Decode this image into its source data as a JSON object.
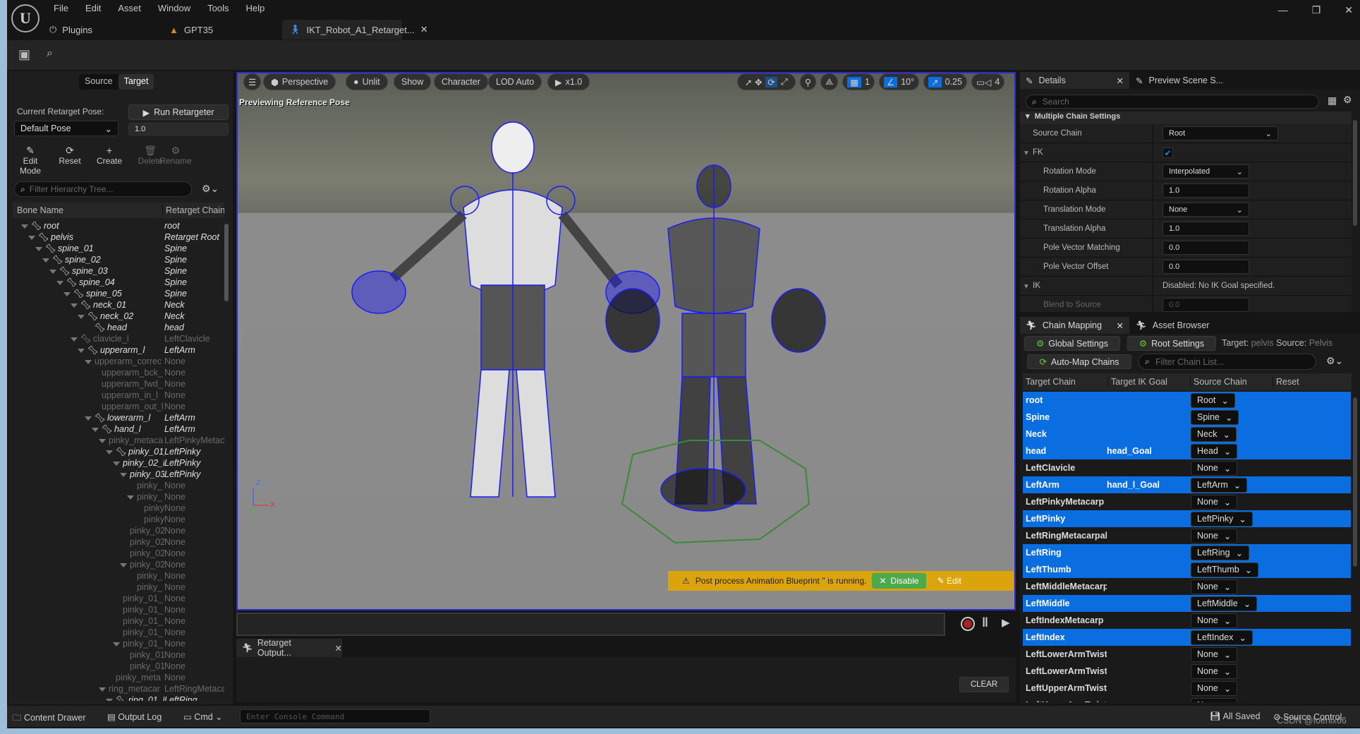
{
  "menu": [
    "File",
    "Edit",
    "Asset",
    "Window",
    "Tools",
    "Help"
  ],
  "tabs": [
    {
      "label": "Plugins",
      "icon": "plug-icon"
    },
    {
      "label": "GPT35",
      "icon": "level-icon"
    },
    {
      "label": "IKT_Robot_A1_Retarget...",
      "icon": "retargeter-icon",
      "active": true
    }
  ],
  "left": {
    "source_label": "Source",
    "target_label": "Target",
    "pose_label": "Current Retarget Pose:",
    "run_label": "Run Retargeter",
    "pose_value": "Default Pose",
    "blend_value": "1.0",
    "tools": [
      {
        "label": "Edit Mode",
        "icon": "pencil-icon"
      },
      {
        "label": "Reset",
        "icon": "reset-icon"
      },
      {
        "label": "Create",
        "icon": "plus-icon"
      },
      {
        "label": "Delete",
        "icon": "trash-icon",
        "disabled": true
      },
      {
        "label": "Rename",
        "icon": "gear-icon",
        "disabled": true
      }
    ],
    "filter_placeholder": "Filter Hierarchy Tree...",
    "col_bone": "Bone Name",
    "col_chain": "Retarget Chain"
  },
  "tree": [
    {
      "n": "root",
      "c": "root",
      "d": 0,
      "i": 1,
      "e": 1
    },
    {
      "n": "pelvis",
      "c": "Retarget Root",
      "d": 1,
      "i": 1,
      "e": 1
    },
    {
      "n": "spine_01",
      "c": "Spine",
      "d": 2,
      "i": 1,
      "e": 1
    },
    {
      "n": "spine_02",
      "c": "Spine",
      "d": 3,
      "i": 1,
      "e": 1
    },
    {
      "n": "spine_03",
      "c": "Spine",
      "d": 4,
      "i": 1,
      "e": 1
    },
    {
      "n": "spine_04",
      "c": "Spine",
      "d": 5,
      "i": 1,
      "e": 1
    },
    {
      "n": "spine_05",
      "c": "Spine",
      "d": 6,
      "i": 1,
      "e": 1
    },
    {
      "n": "neck_01",
      "c": "Neck",
      "d": 7,
      "i": 1,
      "e": 1
    },
    {
      "n": "neck_02",
      "c": "Neck",
      "d": 8,
      "i": 1,
      "e": 1
    },
    {
      "n": "head",
      "c": "head",
      "d": 9,
      "i": 1
    },
    {
      "n": "clavicle_l",
      "c": "LeftClavicle",
      "d": 7,
      "i": 1,
      "e": 1,
      "dim": 1
    },
    {
      "n": "upperarm_l",
      "c": "LeftArm",
      "d": 8,
      "i": 1,
      "e": 1
    },
    {
      "n": "upperarm_correc",
      "c": "None",
      "d": 9,
      "e": 1,
      "dim": 1
    },
    {
      "n": "upperarm_bck_",
      "c": "None",
      "d": 10,
      "dim": 1
    },
    {
      "n": "upperarm_fwd_",
      "c": "None",
      "d": 10,
      "dim": 1
    },
    {
      "n": "upperarm_in_l",
      "c": "None",
      "d": 10,
      "dim": 1
    },
    {
      "n": "upperarm_out_l",
      "c": "None",
      "d": 10,
      "dim": 1
    },
    {
      "n": "lowerarm_l",
      "c": "LeftArm",
      "d": 9,
      "i": 1,
      "e": 1
    },
    {
      "n": "hand_l",
      "c": "LeftArm",
      "d": 10,
      "i": 1,
      "e": 1
    },
    {
      "n": "pinky_metaca",
      "c": "LeftPinkyMetac",
      "d": 11,
      "e": 1,
      "dim": 1
    },
    {
      "n": "pinky_01_l",
      "c": "LeftPinky",
      "d": 12,
      "i": 1,
      "e": 1
    },
    {
      "n": "pinky_02_l",
      "c": "LeftPinky",
      "d": 13,
      "e": 1
    },
    {
      "n": "pinky_03",
      "c": "LeftPinky",
      "d": 14,
      "e": 1
    },
    {
      "n": "pinky_",
      "c": "None",
      "d": 15,
      "dim": 1
    },
    {
      "n": "pinky_",
      "c": "None",
      "d": 15,
      "e": 1,
      "dim": 1
    },
    {
      "n": "pinky",
      "c": "None",
      "d": 16,
      "dim": 1
    },
    {
      "n": "pinky",
      "c": "None",
      "d": 16,
      "dim": 1
    },
    {
      "n": "pinky_02",
      "c": "None",
      "d": 14,
      "dim": 1
    },
    {
      "n": "pinky_02",
      "c": "None",
      "d": 14,
      "dim": 1
    },
    {
      "n": "pinky_02",
      "c": "None",
      "d": 14,
      "dim": 1
    },
    {
      "n": "pinky_02",
      "c": "None",
      "d": 14,
      "e": 1,
      "dim": 1
    },
    {
      "n": "pinky_",
      "c": "None",
      "d": 15,
      "dim": 1
    },
    {
      "n": "pinky_",
      "c": "None",
      "d": 15,
      "dim": 1
    },
    {
      "n": "pinky_01_",
      "c": "None",
      "d": 13,
      "dim": 1
    },
    {
      "n": "pinky_01_",
      "c": "None",
      "d": 13,
      "dim": 1
    },
    {
      "n": "pinky_01_",
      "c": "None",
      "d": 13,
      "dim": 1
    },
    {
      "n": "pinky_01_",
      "c": "None",
      "d": 13,
      "dim": 1
    },
    {
      "n": "pinky_01_",
      "c": "None",
      "d": 13,
      "e": 1,
      "dim": 1
    },
    {
      "n": "pinky_01",
      "c": "None",
      "d": 14,
      "dim": 1
    },
    {
      "n": "pinky_01",
      "c": "None",
      "d": 14,
      "dim": 1
    },
    {
      "n": "pinky_meta",
      "c": "None",
      "d": 12,
      "dim": 1
    },
    {
      "n": "ring_metacar",
      "c": "LeftRingMetaca",
      "d": 11,
      "e": 1,
      "dim": 1
    },
    {
      "n": "ring_01_l",
      "c": "LeftRing",
      "d": 12,
      "i": 1,
      "e": 1
    }
  ],
  "viewport": {
    "buttons": [
      "Perspective",
      "Unlit",
      "Show",
      "Character",
      "LOD Auto",
      "x1.0"
    ],
    "grid_value": "1",
    "angle_value": "10°",
    "scale_value": "0.25",
    "camera_speed": "4",
    "overlay_text": "Previewing Reference Pose",
    "warning_text": "Post process Animation Blueprint '' is running.",
    "disable_label": "Disable",
    "edit_label": "Edit",
    "axis_x": "X",
    "axis_y": "Y",
    "axis_z": "Z",
    "accent": "#0a6ee0"
  },
  "output": {
    "tab_label": "Retarget Output...",
    "clear_label": "CLEAR"
  },
  "details": {
    "tab": "Details",
    "tab2": "Preview Scene S...",
    "search_placeholder": "Search",
    "section": "Multiple Chain Settings",
    "rows": [
      {
        "label": "Source Chain",
        "value": "Root",
        "type": "dropdown",
        "indent": 0
      },
      {
        "label": "FK",
        "value": "",
        "type": "checkbox",
        "checked": true,
        "indent": 0,
        "expander": true
      },
      {
        "label": "Rotation Mode",
        "value": "Interpolated",
        "type": "dropdown",
        "indent": 1
      },
      {
        "label": "Rotation Alpha",
        "value": "1.0",
        "type": "number",
        "indent": 1
      },
      {
        "label": "Translation Mode",
        "value": "None",
        "type": "dropdown",
        "indent": 1
      },
      {
        "label": "Translation Alpha",
        "value": "1.0",
        "type": "number",
        "indent": 1
      },
      {
        "label": "Pole Vector Matching",
        "value": "0.0",
        "type": "number",
        "indent": 1
      },
      {
        "label": "Pole Vector Offset",
        "value": "0.0",
        "type": "number",
        "indent": 1
      },
      {
        "label": "IK",
        "value": "Disabled: No IK Goal specified.",
        "type": "text",
        "indent": 0,
        "expander": true
      },
      {
        "label": "Blend to Source",
        "value": "0.0",
        "type": "number",
        "indent": 1,
        "dim": true
      }
    ]
  },
  "chain_mapping": {
    "tab": "Chain Mapping",
    "tab2": "Asset Browser",
    "global_settings": "Global Settings",
    "root_settings": "Root Settings",
    "target_label": "Target:",
    "target_value": "pelvis",
    "source_label": "Source:",
    "source_value": "Pelvis",
    "automap": "Auto-Map Chains",
    "filter_placeholder": "Filter Chain List...",
    "columns": [
      "Target Chain",
      "Target IK Goal",
      "Source Chain",
      "Reset"
    ],
    "rows": [
      {
        "t": "root",
        "ik": "",
        "s": "Root",
        "sel": true
      },
      {
        "t": "Spine",
        "ik": "",
        "s": "Spine",
        "sel": true
      },
      {
        "t": "Neck",
        "ik": "",
        "s": "Neck",
        "sel": true
      },
      {
        "t": "head",
        "ik": "head_Goal",
        "s": "Head",
        "sel": true
      },
      {
        "t": "LeftClavicle",
        "ik": "",
        "s": "None"
      },
      {
        "t": "LeftArm",
        "ik": "hand_l_Goal",
        "s": "LeftArm",
        "sel": true
      },
      {
        "t": "LeftPinkyMetacarp",
        "ik": "",
        "s": "None"
      },
      {
        "t": "LeftPinky",
        "ik": "",
        "s": "LeftPinky",
        "sel": true
      },
      {
        "t": "LeftRingMetacarpal",
        "ik": "",
        "s": "None"
      },
      {
        "t": "LeftRing",
        "ik": "",
        "s": "LeftRing",
        "sel": true
      },
      {
        "t": "LeftThumb",
        "ik": "",
        "s": "LeftThumb",
        "sel": true
      },
      {
        "t": "LeftMiddleMetacarpal",
        "ik": "",
        "s": "None"
      },
      {
        "t": "LeftMiddle",
        "ik": "",
        "s": "LeftMiddle",
        "sel": true
      },
      {
        "t": "LeftIndexMetacarp",
        "ik": "",
        "s": "None"
      },
      {
        "t": "LeftIndex",
        "ik": "",
        "s": "LeftIndex",
        "sel": true
      },
      {
        "t": "LeftLowerArmTwist",
        "ik": "",
        "s": "None"
      },
      {
        "t": "LeftLowerArmTwist",
        "ik": "",
        "s": "None"
      },
      {
        "t": "LeftUpperArmTwist",
        "ik": "",
        "s": "None"
      },
      {
        "t": "LeftUpperArmTwist",
        "ik": "",
        "s": "None"
      }
    ]
  },
  "statusbar": {
    "content_drawer": "Content Drawer",
    "output_log": "Output Log",
    "cmd": "Cmd",
    "console_placeholder": "Enter Console Command",
    "all_saved": "All Saved",
    "source_control": "Source Control",
    "watermark": "CSDN @foenix66"
  }
}
